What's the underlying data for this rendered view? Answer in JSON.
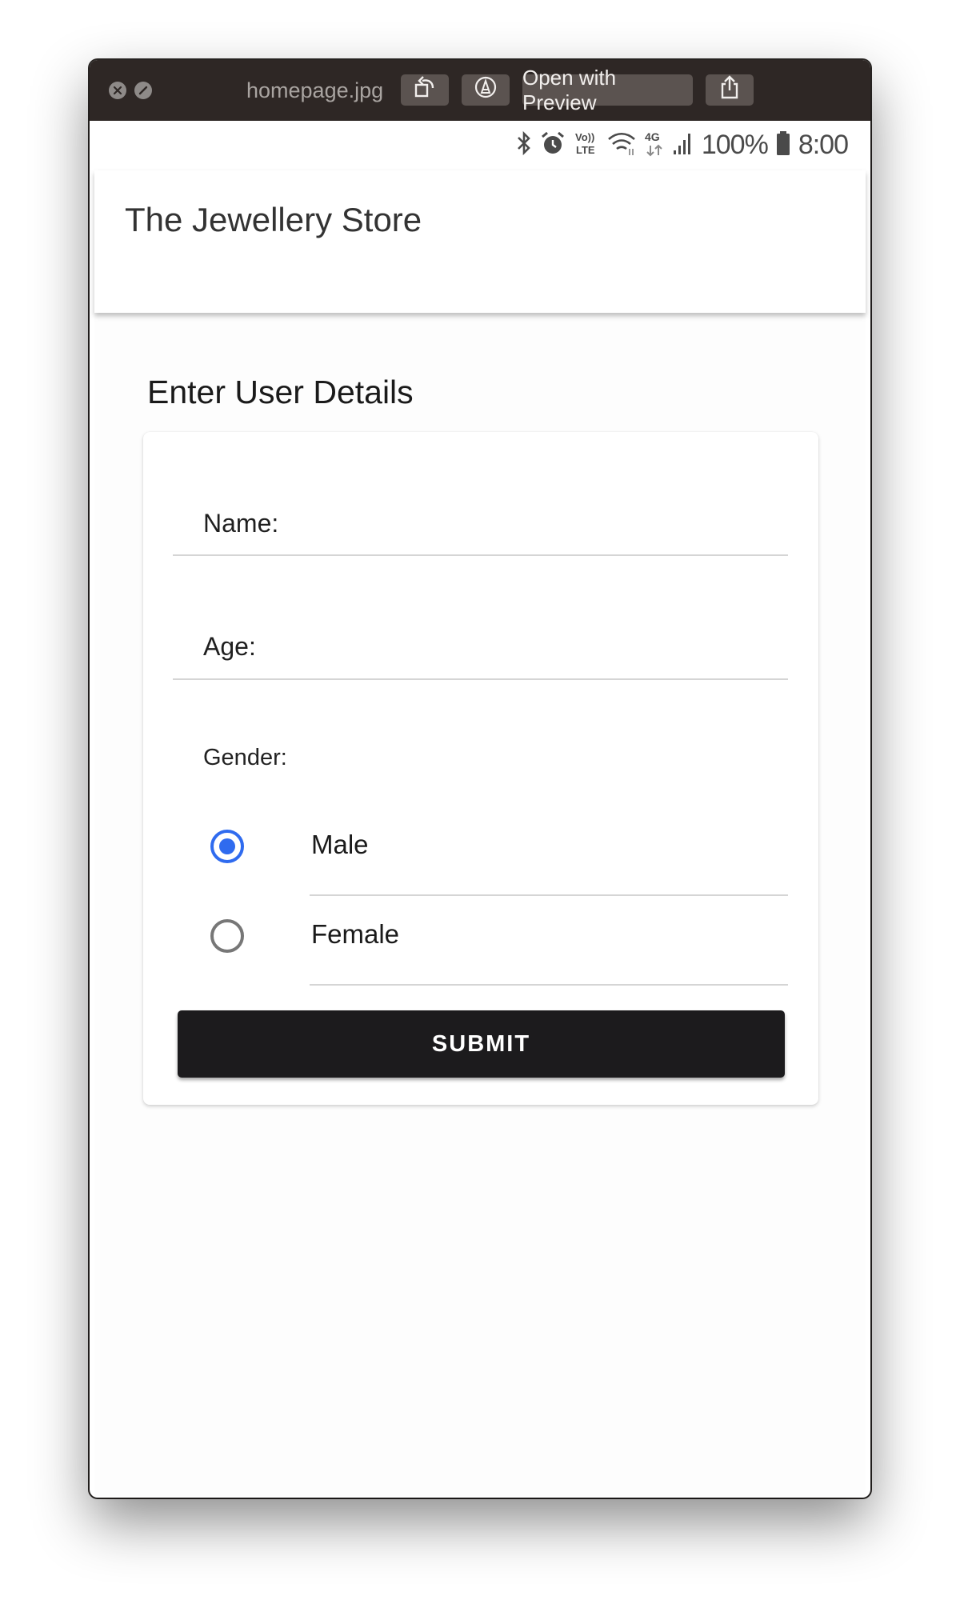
{
  "window": {
    "filename": "homepage.jpg",
    "open_with_label": "Open with Preview"
  },
  "status_bar": {
    "battery_percent": "100%",
    "time": "8:00",
    "network": "4G",
    "volte": "Vo)) LTE"
  },
  "app_bar": {
    "title": "The Jewellery Store"
  },
  "form": {
    "heading": "Enter User Details",
    "name_label": "Name:",
    "age_label": "Age:",
    "gender_label": "Gender:",
    "gender_options": [
      {
        "label": "Male",
        "selected": true
      },
      {
        "label": "Female",
        "selected": false
      }
    ],
    "submit_label": "SUBMIT"
  },
  "colors": {
    "radio_accent": "#2f6bef",
    "submit_bg": "#1c1b1d",
    "titlebar_bg": "#2e2725"
  }
}
